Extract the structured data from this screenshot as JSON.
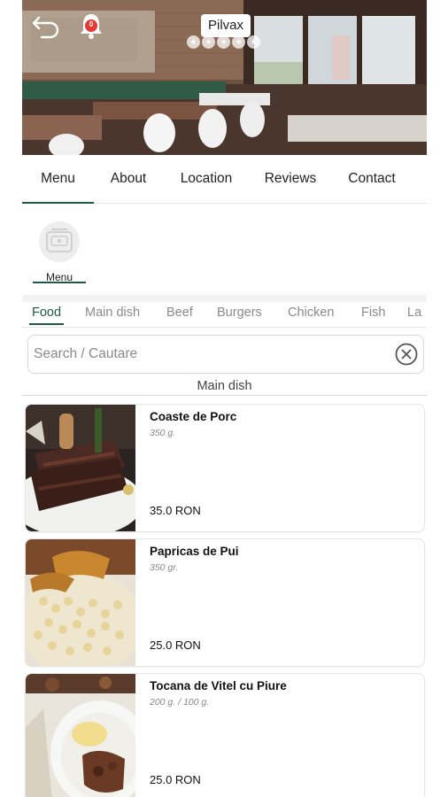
{
  "header": {
    "restaurant_name": "Pilvax",
    "notification_count": "0",
    "rating_stars": 5
  },
  "main_tabs": [
    {
      "label": "Menu",
      "active": true
    },
    {
      "label": "About",
      "active": false
    },
    {
      "label": "Location",
      "active": false
    },
    {
      "label": "Reviews",
      "active": false
    },
    {
      "label": "Contact",
      "active": false
    }
  ],
  "menu_card": {
    "label": "Menu"
  },
  "categories": [
    {
      "label": "Food",
      "active": true
    },
    {
      "label": "Main dish",
      "active": false
    },
    {
      "label": "Beef",
      "active": false
    },
    {
      "label": "Burgers",
      "active": false
    },
    {
      "label": "Chicken",
      "active": false
    },
    {
      "label": "Fish",
      "active": false
    },
    {
      "label": "La",
      "active": false
    }
  ],
  "search": {
    "placeholder": "Search / Cautare"
  },
  "section": {
    "title": "Main dish"
  },
  "dishes": [
    {
      "name": "Coaste de Porc",
      "weight": "350 g.",
      "price": "35.0 RON"
    },
    {
      "name": "Papricas de Pui",
      "weight": "350 gr.",
      "price": "25.0 RON"
    },
    {
      "name": "Tocana de Vitel cu Piure",
      "weight": "200 g. / 100 g.",
      "price": "25.0 RON"
    }
  ],
  "colors": {
    "accent": "#1f5a45",
    "notification": "#e53935"
  }
}
